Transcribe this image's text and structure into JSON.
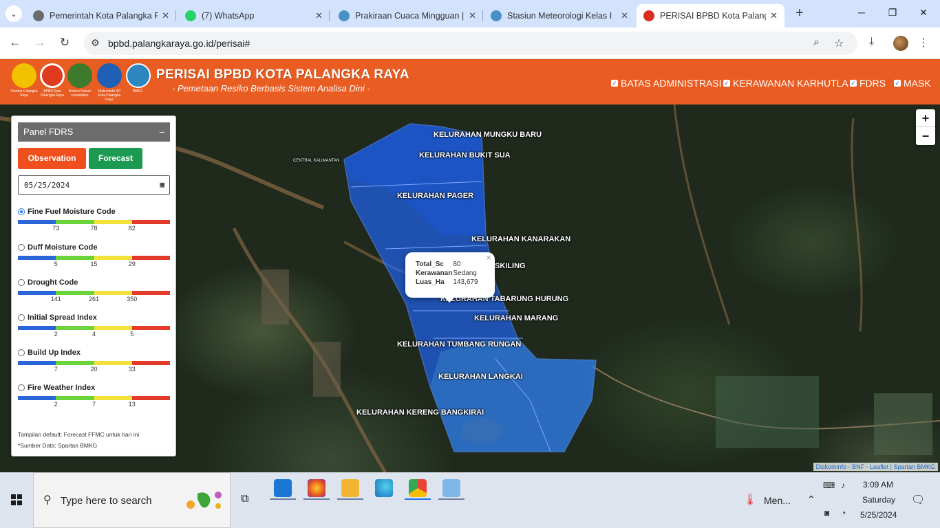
{
  "browser": {
    "tabs": [
      {
        "title": "Pemerintah Kota Palangka Raya",
        "fav_color": "#6b6b6b"
      },
      {
        "title": "(7) WhatsApp",
        "fav_color": "#25d366"
      },
      {
        "title": "Prakiraan Cuaca Mingguan |",
        "fav_color": "#4a90c8"
      },
      {
        "title": "Stasiun Meteorologi Kelas I",
        "fav_color": "#4a90c8"
      },
      {
        "title": "PERISAI BPBD Kota Palangka",
        "fav_color": "#d62f1f"
      }
    ],
    "url": "bpbd.palangkaraya.go.id/perisai#"
  },
  "header": {
    "title": "PERISAI BPBD KOTA PALANGKA RAYA",
    "subtitle": "- Pemetaan Resiko Berbasis Sistem Analisa Dini -",
    "logos": [
      {
        "caption": "Pemkot Palangka Raya",
        "color": "#f2c200"
      },
      {
        "caption": "BPBD Kota Palangka Raya",
        "color": "#e03a1f"
      },
      {
        "caption": "Borneo Nature Foundation",
        "color": "#3e7a2c"
      },
      {
        "caption": "Diskominfo-SP Kota Palangka Raya",
        "color": "#1f5fb5"
      },
      {
        "caption": "BMKG",
        "color": "#2e86c1"
      }
    ],
    "layers": [
      "BATAS ADMINISTRASI",
      "KERAWANAN KARHUTLA",
      "FDRS",
      "MASK"
    ]
  },
  "panel": {
    "title": "Panel FDRS",
    "minimize": "–",
    "observation_label": "Observation",
    "forecast_label": "Forecast",
    "date_value": "05/25/2024",
    "colors": {
      "blue": "#2a66d9",
      "green": "#6ad43a",
      "yellow": "#f4e23a",
      "red": "#e43a2c"
    },
    "indices": [
      {
        "name": "Fine Fuel Moisture Code",
        "selected": true,
        "ticks": [
          "73",
          "78",
          "82"
        ]
      },
      {
        "name": "Duff Moisture Code",
        "selected": false,
        "ticks": [
          "5",
          "15",
          "29"
        ]
      },
      {
        "name": "Drought Code",
        "selected": false,
        "ticks": [
          "141",
          "261",
          "350"
        ]
      },
      {
        "name": "Initial Spread Index",
        "selected": false,
        "ticks": [
          "2",
          "4",
          "5"
        ]
      },
      {
        "name": "Build Up Index",
        "selected": false,
        "ticks": [
          "7",
          "20",
          "33"
        ]
      },
      {
        "name": "Fire Weather Index",
        "selected": false,
        "ticks": [
          "2",
          "7",
          "13"
        ]
      }
    ],
    "note_default": "Tampilan default: Forecast FFMC untuk hari ini",
    "note_source": "*Sumber Data: Spartan BMKG"
  },
  "map": {
    "labels": [
      "KELURAHAN MUNGKU BARU",
      "KELURAHAN BUKIT SUA",
      "KELURAHAN PAGER",
      "KELURAHAN KANARAKAN",
      "SKILING",
      "KELURAHAN TABARUNG HURUNG",
      "KELURAHAN MARANG",
      "KELURAHAN TUMBANG RUNGAN",
      "KELURAHAN LANGKAI",
      "KELURAHAN KERENG BANGKIRAI"
    ],
    "small_labels": [
      "CENTRAL KALIMANTAN"
    ],
    "popup": {
      "rows": [
        {
          "key": "Total_Sc",
          "value": "80"
        },
        {
          "key": "Kerawanan",
          "value": "Sedang"
        },
        {
          "key": "Luas_Ha",
          "value": "143,679"
        }
      ],
      "close": "×"
    },
    "zoom_in": "+",
    "zoom_out": "−",
    "attribution": "Diskominfo - BNF - Leaflet | Spartan BMKG"
  },
  "taskbar": {
    "search_placeholder": "Type here to search",
    "weather_label": "Men...",
    "time": "3:09 AM",
    "day": "Saturday",
    "date": "5/25/2024"
  }
}
